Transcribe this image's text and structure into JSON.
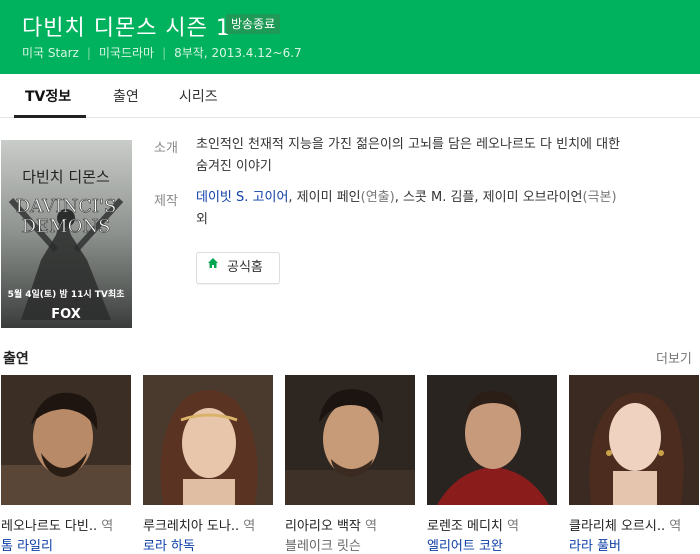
{
  "header": {
    "title": "다빈치 디몬스 시즌 1",
    "badge": "방송종료",
    "meta": [
      "미국 Starz",
      "미국드라마",
      "8부작, 2013.4.12~6.7"
    ]
  },
  "tabs": [
    {
      "label": "TV정보",
      "active": true
    },
    {
      "label": "출연",
      "active": false
    },
    {
      "label": "시리즈",
      "active": false
    }
  ],
  "poster": {
    "title_kr": "다빈치 디몬스",
    "title_en_1": "DAVINCI'S",
    "title_en_2": "DEMONS",
    "air": "5월 4일(토) 밤 11시 TV최초",
    "network": "FOX"
  },
  "info": {
    "synopsis_label": "소개",
    "synopsis": [
      "초인적인 천재적 지능을 가진 젊은이의 고뇌를 담은 레오나르도 다 빈치에 대한",
      "숨겨진 이야기"
    ],
    "credits_label": "제작",
    "creator_link": "데이빗 S. 고이어",
    "credits_rest": ", 제이미 페인",
    "credits_role1": "(연출)",
    "credits_rest2": ", 스콧 M. 김플, 제이미 오브라이언",
    "credits_role2": "(극본)",
    "credits_line2": "외",
    "home_button": "공식홈"
  },
  "cast_section": {
    "title": "출연",
    "more": "더보기",
    "suffix": "역",
    "members": [
      {
        "role": "레오나르도 다빈..",
        "actor": "톰 라일리",
        "linked": true
      },
      {
        "role": "루크레치아 도나..",
        "actor": "로라 하독",
        "linked": true
      },
      {
        "role": "리아리오 백작",
        "actor": "블레이크 릿슨",
        "linked": false
      },
      {
        "role": "로렌조 메디치",
        "actor": "엘리어트 코완",
        "linked": true
      },
      {
        "role": "클라리체 오르시..",
        "actor": "라라 풀버",
        "linked": true
      }
    ]
  },
  "colors": {
    "brand_green": "#00b15d",
    "link_blue": "#0d3fa8"
  }
}
